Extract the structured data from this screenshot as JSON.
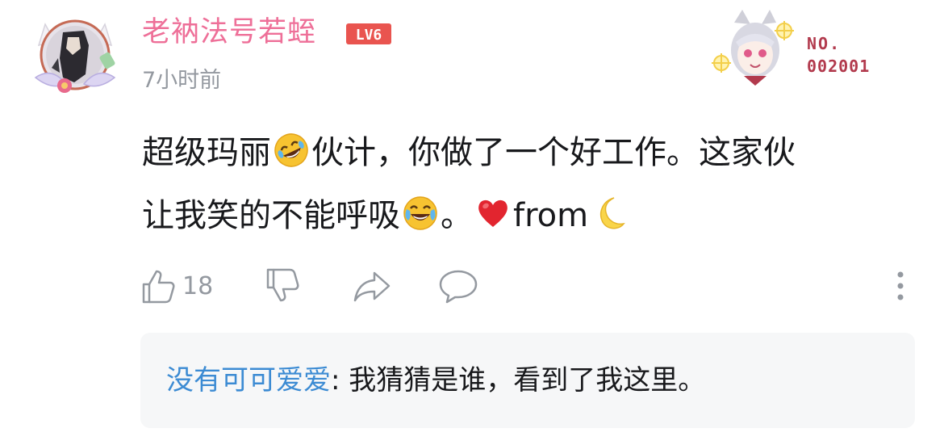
{
  "comment": {
    "username": "老衲法号若蛭",
    "level": "LV6",
    "timestamp": "7小时前",
    "avatar_icon": "avatar-frame-icon",
    "fan_card": {
      "no_label": "NO.",
      "no_value": "002001"
    },
    "text_line1_a": "超级玛丽",
    "text_line1_b": "伙计，你做了一个好工作。这家伙",
    "text_line2_a": "让我笑的不能呼吸",
    "text_line2_b": "。",
    "text_line2_c": "from",
    "emojis": [
      "rofl-emoji",
      "joy-emoji",
      "heart-emoji",
      "crescent-moon-emoji"
    ]
  },
  "actions": {
    "like_count": "18",
    "icons": [
      "thumb-up-icon",
      "thumb-down-icon",
      "share-icon",
      "comment-icon",
      "more-icon"
    ]
  },
  "reply": {
    "user": "没有可可爱爱",
    "separator": ": ",
    "text": "我猜猜是谁，看到了我这里。"
  },
  "colors": {
    "username": "#ee6f98",
    "level_badge": "#e9544f",
    "reply_user": "#3c8bd3",
    "muted": "#9499a0",
    "reply_bg": "#f6f7f8"
  }
}
